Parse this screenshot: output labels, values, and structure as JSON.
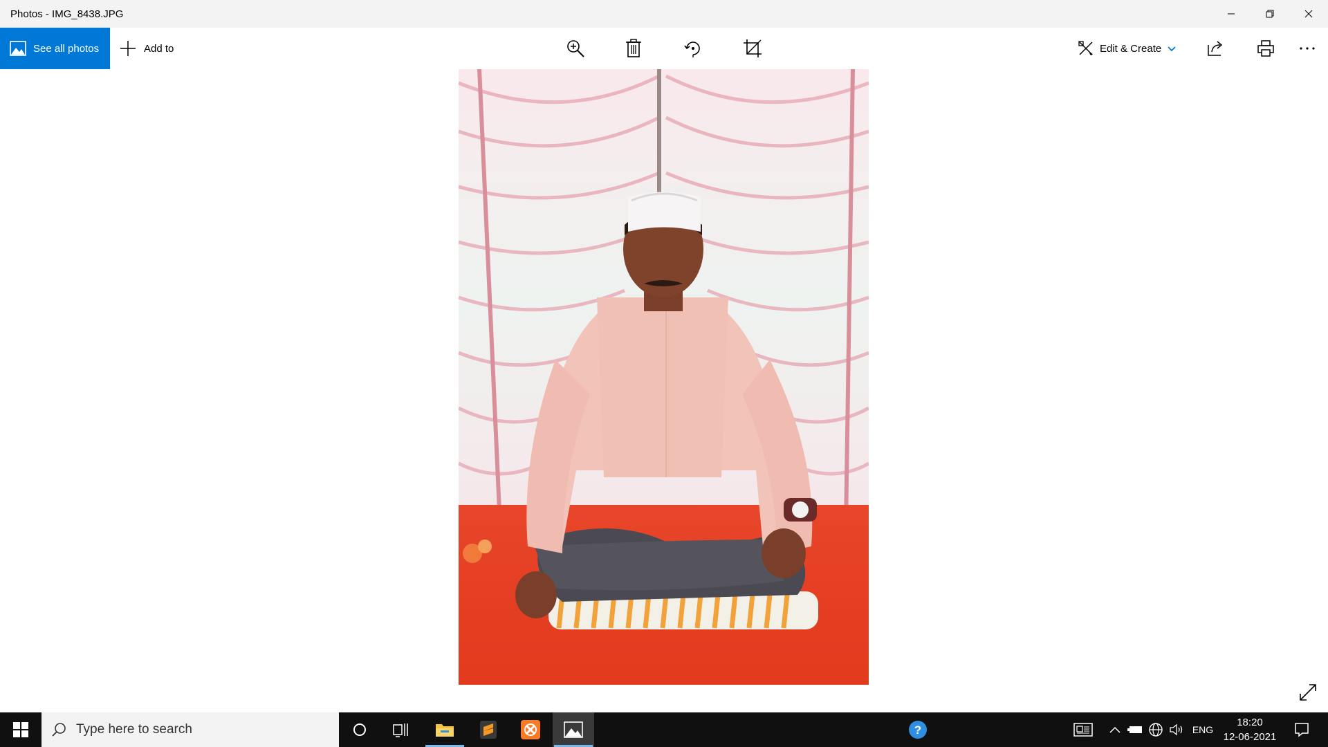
{
  "window": {
    "title": "Photos - IMG_8438.JPG"
  },
  "toolbar": {
    "see_all_label": "See all photos",
    "add_to_label": "Add to",
    "edit_create_label": "Edit & Create",
    "icons": [
      "zoom-icon",
      "delete-icon",
      "rotate-icon",
      "crop-icon",
      "share-icon",
      "print-icon",
      "more-icon"
    ]
  },
  "colors": {
    "accent": "#0078d7",
    "taskbar": "#101010",
    "active_underline": "#76b9ed"
  },
  "taskbar": {
    "search_placeholder": "Type here to search",
    "apps": [
      "cortana-icon",
      "task-view-icon",
      "file-explorer-icon",
      "sublime-text-icon",
      "xampp-icon",
      "photos-icon"
    ],
    "language": "ENG",
    "time": "18:20",
    "date": "12-06-2021"
  }
}
